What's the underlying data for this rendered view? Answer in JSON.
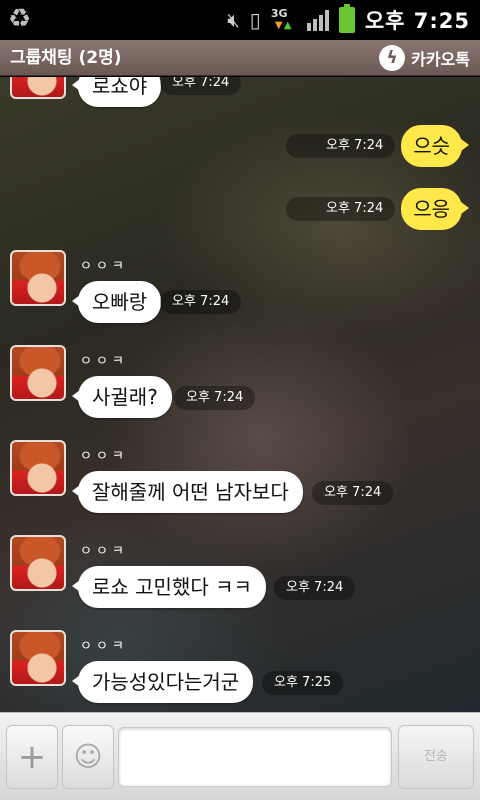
{
  "status_bar": {
    "time": "오후 7:25",
    "network": "3G",
    "icons": [
      "recycle-icon",
      "mute-icon",
      "vibrate-icon",
      "signal-icon",
      "battery-icon"
    ],
    "battery_color": "#69c631"
  },
  "header": {
    "title": "그룹채팅 (2명)",
    "brand_name": "카카오톡",
    "brand_icon": "kakao-lightning-icon"
  },
  "messages": [
    {
      "direction": "in",
      "text": "로쇼야",
      "time": "오후 7:24",
      "sender": ""
    },
    {
      "direction": "out",
      "text": "으슷",
      "time": "오후 7:24"
    },
    {
      "direction": "out",
      "text": "으응",
      "time": "오후 7:24"
    },
    {
      "direction": "in",
      "sender": "ㅇㅇㅋ",
      "text": "오빠랑",
      "time": "오후 7:24"
    },
    {
      "direction": "in",
      "sender": "ㅇㅇㅋ",
      "text": "사귈래?",
      "time": "오후 7:24"
    },
    {
      "direction": "in",
      "sender": "ㅇㅇㅋ",
      "text": "잘해줄께 어떤 남자보다",
      "time": "오후 7:24"
    },
    {
      "direction": "in",
      "sender": "ㅇㅇㅋ",
      "text": "로쇼 고민했다 ㅋㅋ",
      "time": "오후 7:24"
    },
    {
      "direction": "in",
      "sender": "ㅇㅇㅋ",
      "text": "가능성있다는거군",
      "time": "오후 7:25"
    }
  ],
  "input_bar": {
    "plus_label": "+",
    "emoticon_icon": "emoticon-icon",
    "input_value": "",
    "input_placeholder": "",
    "send_label": "전송"
  },
  "colors": {
    "my_bubble": "#ffe84a",
    "their_bubble": "#ffffff",
    "title_bar": "#7a6762"
  }
}
